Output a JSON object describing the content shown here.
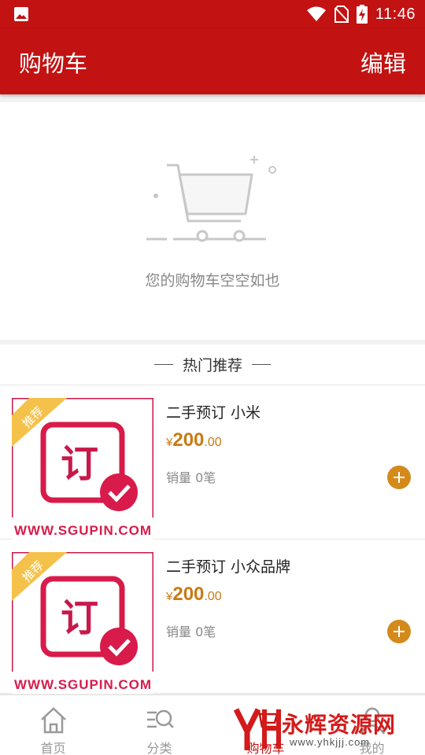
{
  "status_bar": {
    "time": "11:46",
    "icons": [
      "image-icon",
      "wifi-icon",
      "no-sim-icon",
      "battery-charging-icon"
    ]
  },
  "app_bar": {
    "title": "购物车",
    "edit_label": "编辑"
  },
  "empty_cart": {
    "message": "您的购物车空空如也",
    "icon": "empty-cart-icon"
  },
  "recommend": {
    "title": "热门推荐",
    "products": [
      {
        "name": "二手预订 小米",
        "currency": "¥",
        "price_int": "200",
        "price_dec": ".00",
        "sales": "销量 0笔",
        "badge": "推荐",
        "image_glyph": "订",
        "image_caption": "WWW.SGUPIN.COM"
      },
      {
        "name": "二手预订 小众品牌",
        "currency": "¥",
        "price_int": "200",
        "price_dec": ".00",
        "sales": "销量 0笔",
        "badge": "推荐",
        "image_glyph": "订",
        "image_caption": "WWW.SGUPIN.COM"
      }
    ]
  },
  "tabs": [
    {
      "label": "首页",
      "icon": "home-icon",
      "active": false
    },
    {
      "label": "分类",
      "icon": "category-search-icon",
      "active": false
    },
    {
      "label": "购物车",
      "icon": "cart-icon",
      "active": true
    },
    {
      "label": "我的",
      "icon": "profile-icon",
      "active": false
    }
  ],
  "watermark": {
    "name": "永辉资源网",
    "url": "www.yhkjjj.com"
  },
  "colors": {
    "primary": "#c21212",
    "price": "#c97a13",
    "add_button": "#d48a1b",
    "inactive_tab": "#999999"
  }
}
